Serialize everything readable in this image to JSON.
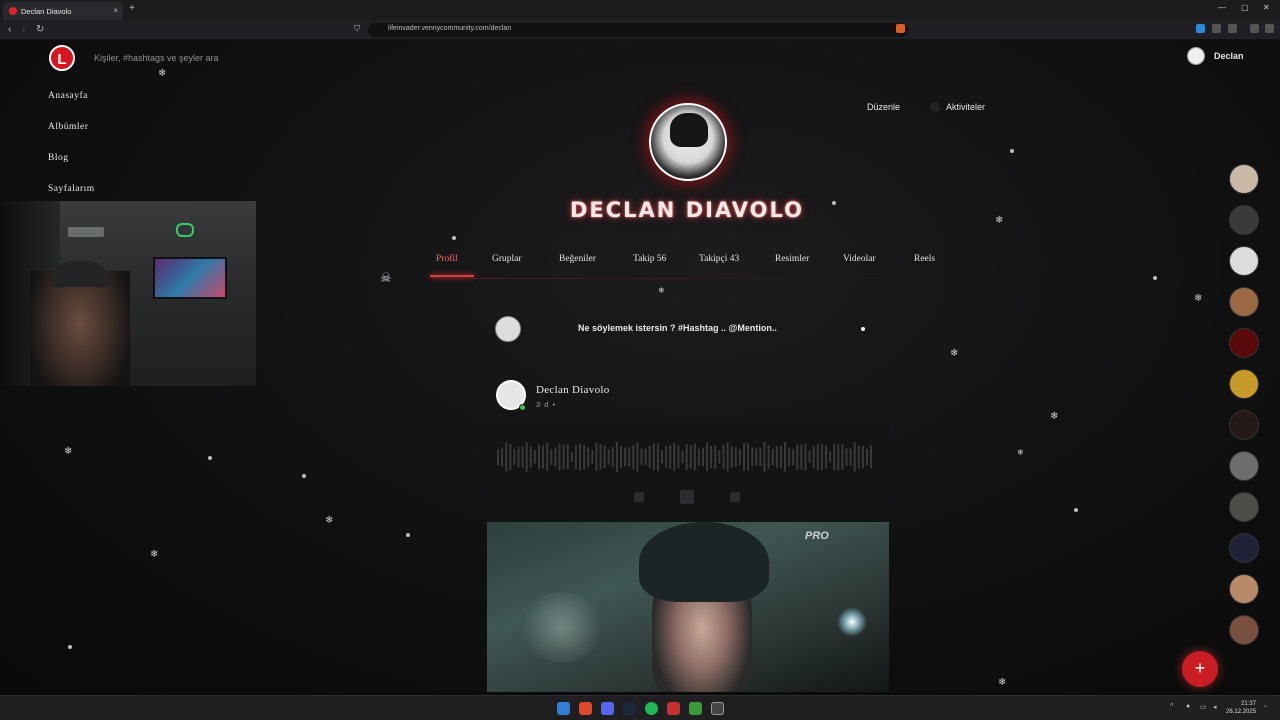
{
  "browser": {
    "tab_title": "Declan Diavolo",
    "tab_close": "×",
    "new_tab": "+",
    "url": "lifeinvader.vennycommunity.com/declan",
    "win_min": "—",
    "win_max": "▢",
    "win_close": "✕",
    "back": "‹",
    "forward": "›",
    "reload": "↻"
  },
  "site": {
    "logo_letter": "L",
    "search_placeholder": "Kişiler, #hashtags ve şeyler ara",
    "user_name": "Declan",
    "brand_color": "#d8151c"
  },
  "menu": [
    "Anasayfa",
    "Albümler",
    "Blog",
    "Sayfalarım"
  ],
  "profile": {
    "name": "DECLAN DIAVOLO",
    "edit_label": "Düzenle",
    "activities_label": "Aktiviteler",
    "tabs": [
      {
        "label": "Profil"
      },
      {
        "label": "Gruplar"
      },
      {
        "label": "Beğeniler"
      },
      {
        "label": "Takip",
        "count": "56"
      },
      {
        "label": "Takipçi",
        "count": "43"
      },
      {
        "label": "Resimler"
      },
      {
        "label": "Videolar"
      },
      {
        "label": "Reels"
      }
    ]
  },
  "composer": {
    "placeholder": "Ne söylemek istersin ? #Hashtag .. @Mention.."
  },
  "post": {
    "author": "Declan Diavolo",
    "time": "3 d •",
    "image_text": "PRO"
  },
  "fab": {
    "label": "+"
  },
  "taskbar": {
    "time": "21:37",
    "date": "26.12.2025"
  }
}
